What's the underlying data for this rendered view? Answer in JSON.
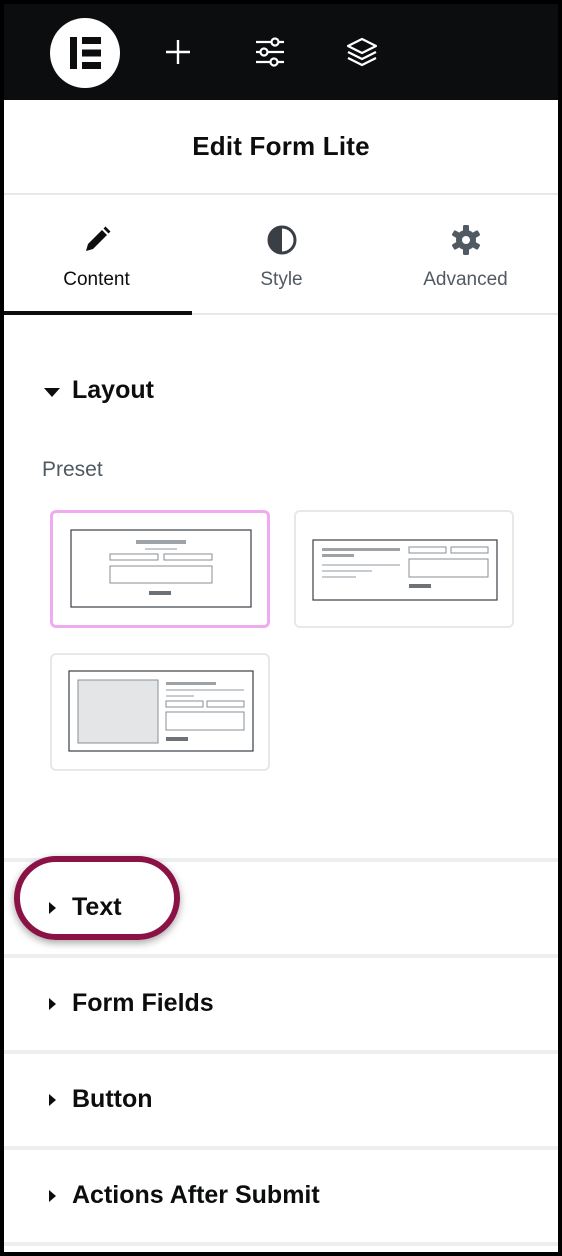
{
  "colors": {
    "topbar": "#0c0d0e",
    "accent_highlight": "#8b1245",
    "preset_selected_border": "#f0aaf0",
    "muted_text": "#515962"
  },
  "topbar": {
    "logo_icon": "elementor-logo-icon",
    "icons": [
      "add-icon",
      "settings-sliders-icon",
      "layers-icon"
    ]
  },
  "header": {
    "title": "Edit Form Lite"
  },
  "tabs": [
    {
      "label": "Content",
      "icon": "pencil-icon",
      "active": true
    },
    {
      "label": "Style",
      "icon": "half-circle-icon",
      "active": false
    },
    {
      "label": "Advanced",
      "icon": "gear-icon",
      "active": false
    }
  ],
  "layout": {
    "title": "Layout",
    "preset_label": "Preset",
    "presets": [
      "centered",
      "two-column",
      "image-left"
    ],
    "selected_preset": "centered"
  },
  "sections": [
    {
      "label": "Text",
      "highlighted": true
    },
    {
      "label": "Form Fields"
    },
    {
      "label": "Button"
    },
    {
      "label": "Actions After Submit"
    }
  ]
}
